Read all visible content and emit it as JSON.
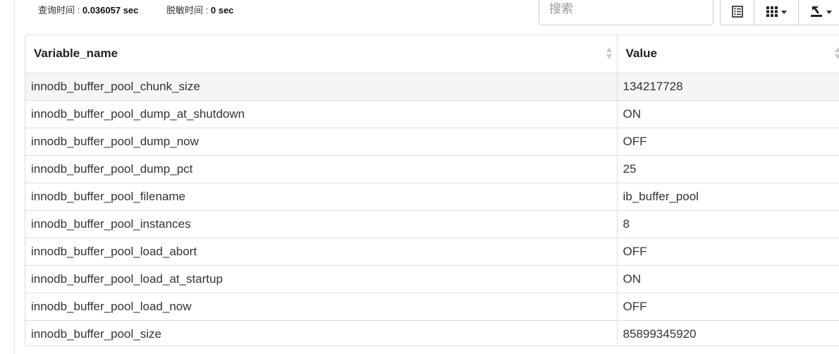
{
  "stats": {
    "query_time_label": "查询时间 :",
    "query_time_value": "0.036057 sec",
    "desens_time_label": "脱敏时间 :",
    "desens_time_value": "0 sec"
  },
  "search": {
    "placeholder": "搜索"
  },
  "toolbar": {
    "buttons": [
      {
        "icon": "list-icon"
      },
      {
        "icon": "columns-grid-icon",
        "dropdown": true
      },
      {
        "icon": "export-icon",
        "dropdown": true
      }
    ]
  },
  "table": {
    "columns": [
      "Variable_name",
      "Value"
    ],
    "rows": [
      [
        "innodb_buffer_pool_chunk_size",
        "134217728"
      ],
      [
        "innodb_buffer_pool_dump_at_shutdown",
        "ON"
      ],
      [
        "innodb_buffer_pool_dump_now",
        "OFF"
      ],
      [
        "innodb_buffer_pool_dump_pct",
        "25"
      ],
      [
        "innodb_buffer_pool_filename",
        "ib_buffer_pool"
      ],
      [
        "innodb_buffer_pool_instances",
        "8"
      ],
      [
        "innodb_buffer_pool_load_abort",
        "OFF"
      ],
      [
        "innodb_buffer_pool_load_at_startup",
        "ON"
      ],
      [
        "innodb_buffer_pool_load_now",
        "OFF"
      ],
      [
        "innodb_buffer_pool_size",
        "85899345920"
      ]
    ]
  }
}
